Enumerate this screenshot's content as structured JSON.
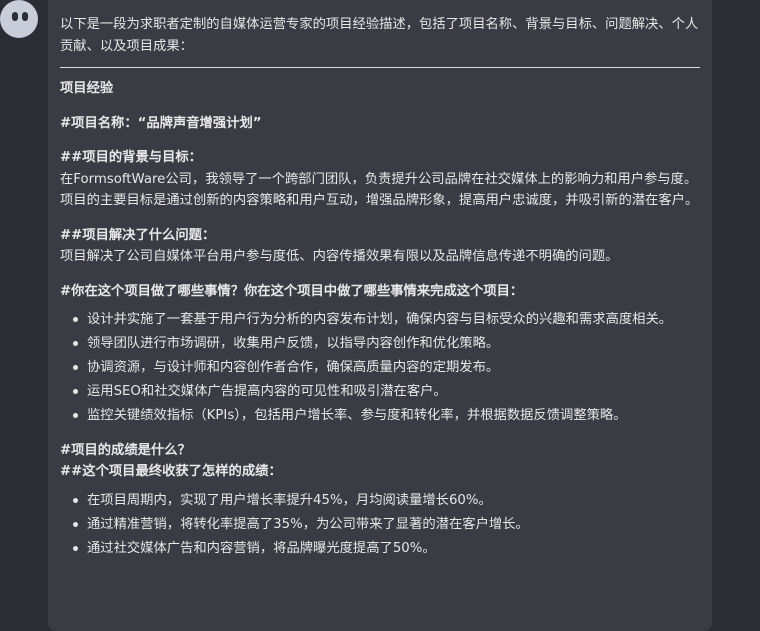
{
  "intro": "以下是一段为求职者定制的自媒体运营专家的项目经验描述，包括了项目名称、背景与目标、问题解决、个人贡献、以及项目成果：",
  "section_title": "项目经验",
  "project_name": "#项目名称：“品牌声音增强计划”",
  "background_heading": "##项目的背景与目标：",
  "background_text": "在FormsoftWare公司，我领导了一个跨部门团队，负责提升公司品牌在社交媒体上的影响力和用户参与度。项目的主要目标是通过创新的内容策略和用户互动，增强品牌形象，提高用户忠诚度，并吸引新的潜在客户。",
  "problem_heading": "##项目解决了什么问题：",
  "problem_text": "项目解决了公司自媒体平台用户参与度低、内容传播效果有限以及品牌信息传递不明确的问题。",
  "contrib_heading": "#你在这个项目做了哪些事情？你在这个项目中做了哪些事情来完成这个项目：",
  "contrib_items": [
    "设计并实施了一套基于用户行为分析的内容发布计划，确保内容与目标受众的兴趣和需求高度相关。",
    "领导团队进行市场调研，收集用户反馈，以指导内容创作和优化策略。",
    "协调资源，与设计师和内容创作者合作，确保高质量内容的定期发布。",
    "运用SEO和社交媒体广告提高内容的可见性和吸引潜在客户。",
    "监控关键绩效指标（KPIs），包括用户增长率、参与度和转化率，并根据数据反馈调整策略。"
  ],
  "results_heading_1": "#项目的成绩是什么？",
  "results_heading_2": "##这个项目最终收获了怎样的成绩：",
  "results_items": [
    "在项目周期内，实现了用户增长率提升45%，月均阅读量增长60%。",
    "通过精准营销，将转化率提高了35%，为公司带来了显著的潜在客户增长。",
    "通过社交媒体广告和内容营销，将品牌曝光度提高了50%。"
  ]
}
